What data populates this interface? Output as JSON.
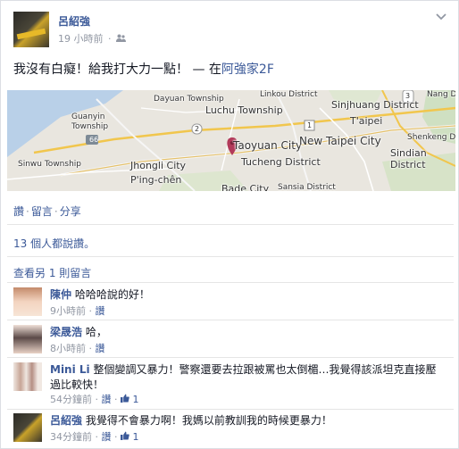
{
  "post": {
    "author": "呂紹強",
    "time": "19 小時前",
    "audience_icon": "friends-icon",
    "status_text": "我沒有白癡！給我打大力一點！",
    "location_prefix": " — 在",
    "location": "阿強家2F"
  },
  "map": {
    "labels": {
      "dayuan": "Dayuan Township",
      "linkou": "Linkou District",
      "luchu": "Luchu Township",
      "sinjhuang": "Sinjhuang District",
      "nangang": "Nang District",
      "guanyin": "Guanyin Township",
      "taoyuan": "Taoyuan City",
      "newtaipei": "New Taipei City",
      "taipei": "T'aipei",
      "shenkeng": "Shenkeng Dis",
      "sinwu": "Sinwu Township",
      "jhongli": "Jhongli City",
      "pingchen": "P'ing-chên",
      "tucheng": "Tucheng District",
      "sindian": "Sindian District",
      "sansia": "Sansia District",
      "bade": "Bade City",
      "route_66": "66",
      "route_2": "2",
      "route_1": "1",
      "route_3": "3"
    }
  },
  "actions": {
    "like": "讚",
    "comment": "留言",
    "share": "分享",
    "separator": "·"
  },
  "likes_text": "13 個人都說讚。",
  "view_more": "查看另 1 則留言",
  "comments": [
    {
      "name": "陳仲",
      "text": "哈哈哈說的好！",
      "time": "9小時前",
      "like": "讚",
      "like_count": ""
    },
    {
      "name": "梁晟浩",
      "text": "哈，",
      "time": "8小時前",
      "like": "讚",
      "like_count": ""
    },
    {
      "name": "Mini Li",
      "text": "整個變調又暴力！警察還要去拉跟被罵也太倒楣…我覺得該派坦克直接壓過比較快！",
      "time": "54分鐘前",
      "like": "讚",
      "like_count": "1"
    },
    {
      "name": "呂紹強",
      "text": "我覺得不會暴力啊！我媽以前教訓我的時候更暴力！",
      "time": "34分鐘前",
      "like": "讚",
      "like_count": "1"
    }
  ],
  "colors": {
    "link": "#3b5998",
    "meta": "#9197a3",
    "map_bg": "#e9e6df",
    "pin": "#b23a5a"
  }
}
